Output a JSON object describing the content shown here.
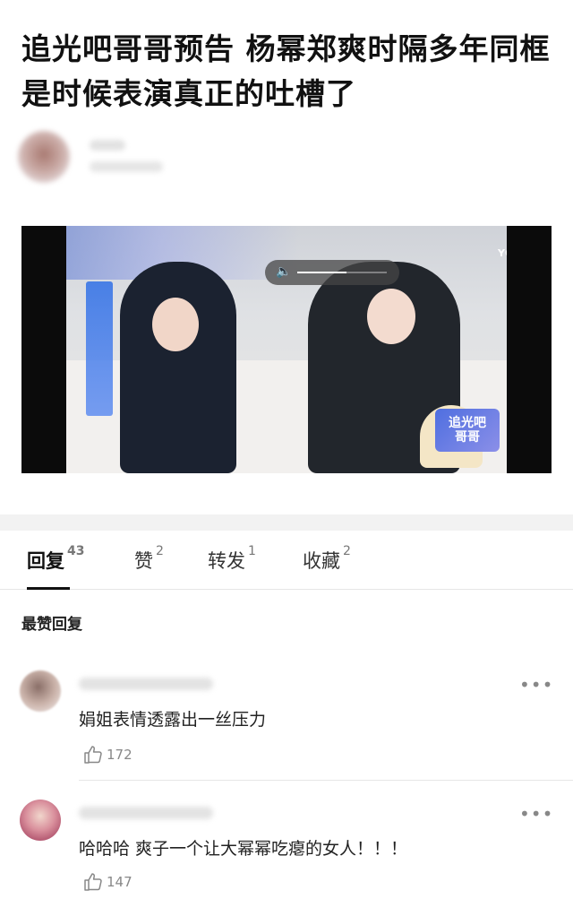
{
  "post": {
    "title": "追光吧哥哥预告 杨幂郑爽时隔多年同框 是时候表演真正的吐槽了"
  },
  "video": {
    "brand": "YOUKU",
    "show_logo_text": "追光吧\n哥哥",
    "volume": 0.55,
    "colors": {
      "accent": "#4f6fe0"
    }
  },
  "tabs": [
    {
      "label": "回复",
      "count": "43"
    },
    {
      "label": "赞",
      "count": "2"
    },
    {
      "label": "转发",
      "count": "1"
    },
    {
      "label": "收藏",
      "count": "2"
    }
  ],
  "section": {
    "label": "最赞回复"
  },
  "comments": [
    {
      "text": "娟姐表情透露出一丝压力",
      "likes": "172",
      "more": "•••"
    },
    {
      "text": "哈哈哈 爽子一个让大幂幂吃瘪的女人！！！",
      "likes": "147",
      "more": "•••"
    }
  ],
  "icons": {
    "like": "thumbs-up-icon",
    "more": "more-dots-icon",
    "speaker": "speaker-icon"
  }
}
